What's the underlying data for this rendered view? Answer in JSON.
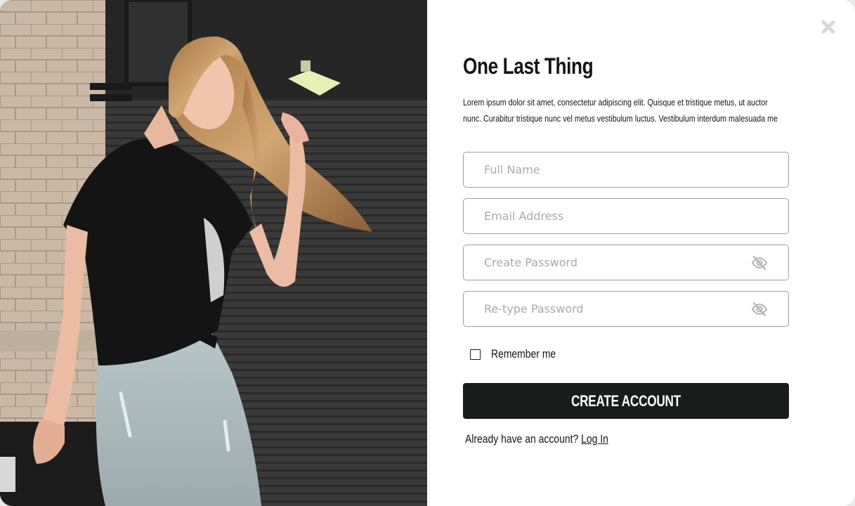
{
  "modal": {
    "title": "One Last Thing",
    "intro": "Lorem ipsum dolor sit amet, consectetur adipiscing elit. Quisque et tristique metus, ut auctor nunc. Curabitur tristique nunc vel metus vestibulum luctus. Vestibulum interdum malesuada me",
    "close_icon": "close-icon"
  },
  "form": {
    "full_name": {
      "placeholder": "Full Name",
      "value": ""
    },
    "email": {
      "placeholder": "Email Address",
      "value": ""
    },
    "password": {
      "placeholder": "Create Password",
      "value": "",
      "icon": "eye-slash-icon"
    },
    "retype_password": {
      "placeholder": "Re-type Password",
      "value": "",
      "icon": "eye-slash-icon"
    },
    "remember_me": {
      "label": "Remember me",
      "checked": false
    },
    "submit_label": "CREATE ACCOUNT",
    "signin_prompt": "Already have an account?",
    "signin_link": "Log In"
  },
  "colors": {
    "button_bg": "#1a1b1b",
    "field_border": "#9e9e9e",
    "placeholder": "#a9a9a9",
    "close_icon": "#d8d8d8"
  }
}
